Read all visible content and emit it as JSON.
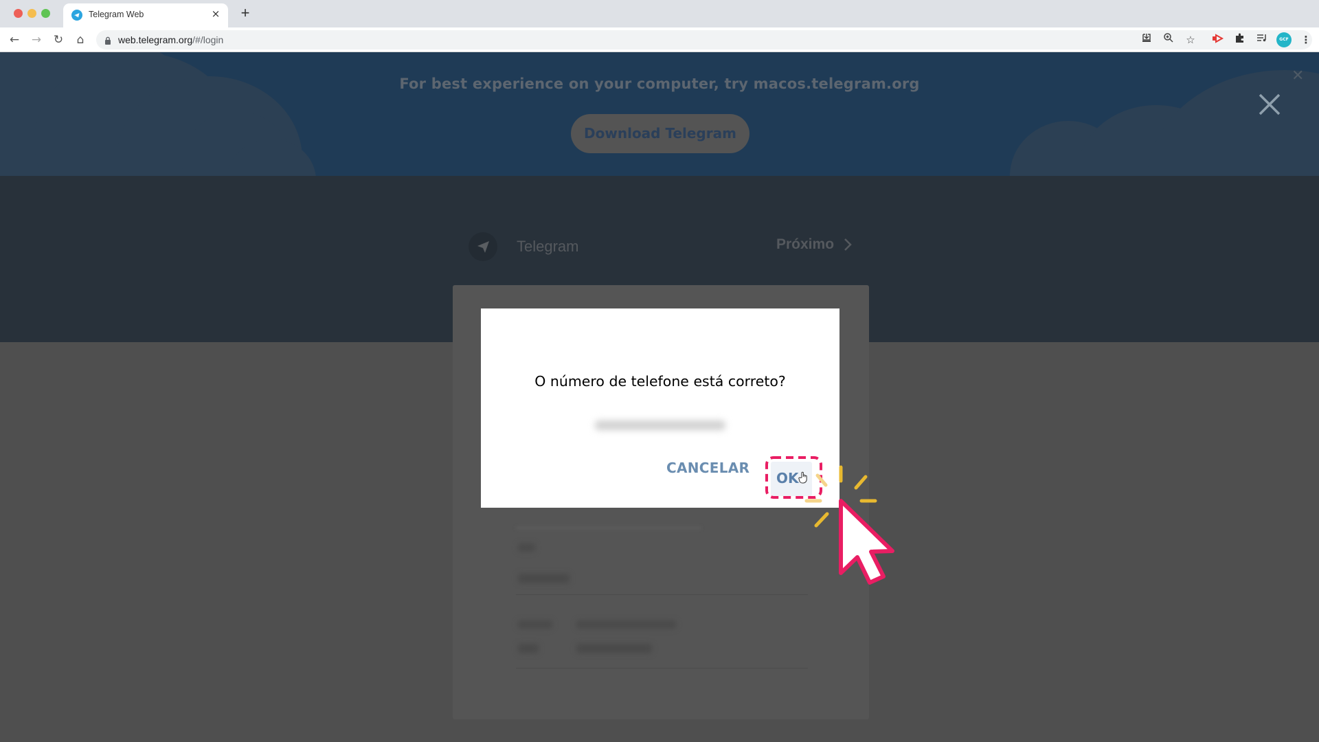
{
  "browser": {
    "tab": {
      "title": "Telegram Web",
      "favicon": "telegram-icon",
      "close": "×"
    },
    "new_tab": "+",
    "nav": {
      "back": "←",
      "forward": "→",
      "reload": "↻",
      "home": "⌂"
    },
    "url": {
      "host": "web.telegram.org",
      "path": "/#/login"
    },
    "toolbar_icons": [
      "install-icon",
      "zoom-icon",
      "bookmark-star-icon",
      "extension-red-icon",
      "extensions-puzzle-icon",
      "media-queue-icon",
      "profile-avatar",
      "menu-kebab-icon"
    ],
    "profile_initials": "GCF"
  },
  "banner": {
    "text": "For best experience on your computer, try macos.telegram.org",
    "download_label": "Download Telegram"
  },
  "header": {
    "title": "Telegram",
    "next_label": "Próximo"
  },
  "modal": {
    "question": "O número de telefone está correto?",
    "phone": "",
    "cancel_label": "CANCELAR",
    "ok_label": "OK"
  },
  "colors": {
    "banner_bg": "#1f3b56",
    "header_bg": "#28313a",
    "overlay_gray": "#4f4f4f",
    "modal_button_text": "#6a8db0",
    "annotation_pink": "#e91e63",
    "annotation_yellow": "#e8b930"
  }
}
